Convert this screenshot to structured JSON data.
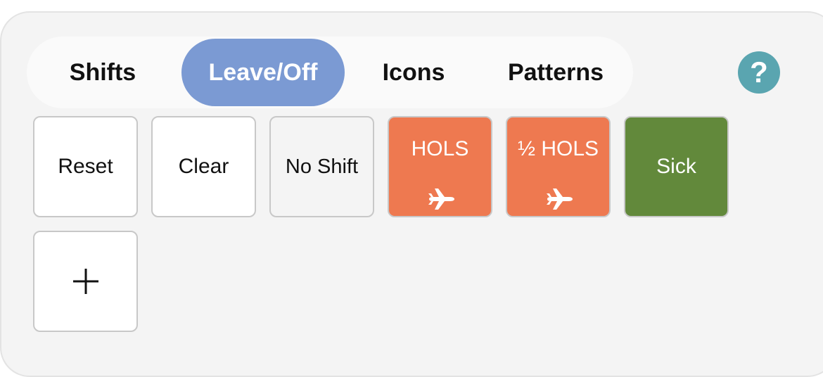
{
  "tabs": [
    {
      "label": "Shifts"
    },
    {
      "label": "Leave/Off"
    },
    {
      "label": "Icons"
    },
    {
      "label": "Patterns"
    }
  ],
  "active_tab": "Leave/Off",
  "help": {
    "label": "?",
    "icon": "help-icon"
  },
  "tiles": [
    {
      "label": "Reset",
      "bg": "#ffffff",
      "text_color": "#111111"
    },
    {
      "label": "Clear",
      "bg": "#ffffff",
      "text_color": "#111111"
    },
    {
      "label": "No Shift",
      "bg": "#f4f4f4",
      "text_color": "#111111"
    },
    {
      "label": "HOLS",
      "bg": "#ee7950",
      "text_color": "#ffffff",
      "icon": "airplane-icon"
    },
    {
      "label": "½ HOLS",
      "bg": "#ee7950",
      "text_color": "#ffffff",
      "icon": "airplane-icon"
    },
    {
      "label": "Sick",
      "bg": "#62893b",
      "text_color": "#ffffff"
    }
  ],
  "add_tile": {
    "icon": "plus-icon"
  },
  "colors": {
    "accent": "#7b9ad3",
    "help": "#5aa5b0",
    "holiday": "#ee7950",
    "sick": "#62893b"
  }
}
